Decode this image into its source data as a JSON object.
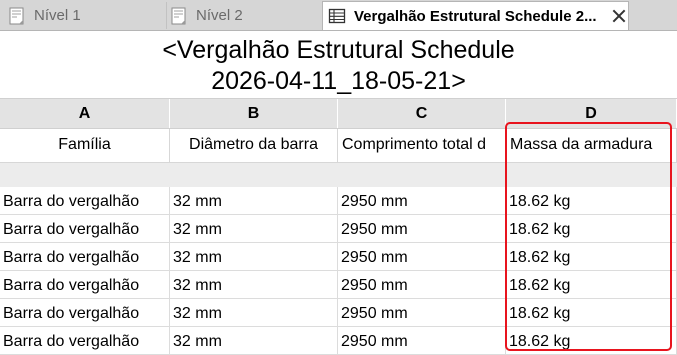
{
  "tabs": [
    {
      "label": "Nível 1",
      "icon": "floor-plan-icon",
      "active": false
    },
    {
      "label": "Nível 2",
      "icon": "floor-plan-icon",
      "active": false
    },
    {
      "label": "Vergalhão Estrutural Schedule 2...",
      "icon": "schedule-table-icon",
      "active": true
    }
  ],
  "schedule": {
    "title_line1": "<Vergalhão Estrutural Schedule",
    "title_line2": "2026-04-11_18-05-21>",
    "column_letters": [
      "A",
      "B",
      "C",
      "D"
    ],
    "column_headers": [
      "Família",
      "Diâmetro da barra",
      "Comprimento total d",
      "Massa da armadura"
    ],
    "rows": [
      [
        "Barra do vergalhão",
        "32 mm",
        "2950 mm",
        "18.62 kg"
      ],
      [
        "Barra do vergalhão",
        "32 mm",
        "2950 mm",
        "18.62 kg"
      ],
      [
        "Barra do vergalhão",
        "32 mm",
        "2950 mm",
        "18.62 kg"
      ],
      [
        "Barra do vergalhão",
        "32 mm",
        "2950 mm",
        "18.62 kg"
      ],
      [
        "Barra do vergalhão",
        "32 mm",
        "2950 mm",
        "18.62 kg"
      ],
      [
        "Barra do vergalhão",
        "32 mm",
        "2950 mm",
        "18.62 kg"
      ]
    ]
  },
  "colors": {
    "highlight": "#e8141e",
    "tab_bar": "#d6d6d6"
  }
}
